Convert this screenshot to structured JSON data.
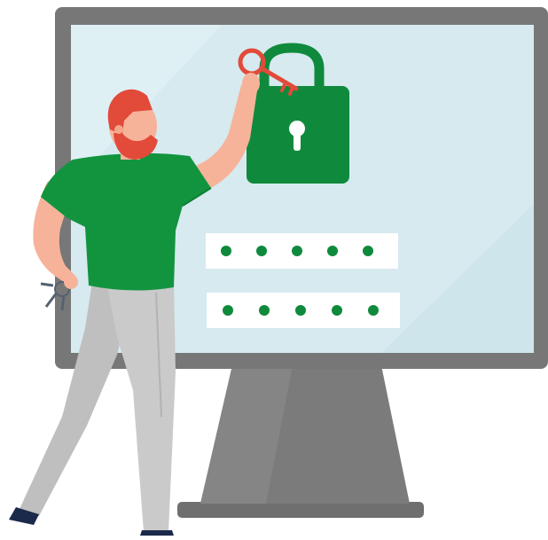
{
  "illustration": {
    "monitor": {
      "frame_color": "#7a7a7a",
      "screen_color": "#d7ebf1",
      "stand_color": "#7d7d7d",
      "base_color": "#737373"
    },
    "padlock": {
      "icon": "padlock-icon",
      "color": "#0f8a3c",
      "shackle_color": "#0f8a3c",
      "keyhole_color": "#ffffff"
    },
    "key": {
      "icon": "key-icon",
      "color": "#e24a3a"
    },
    "password_fields": {
      "dot_color": "#0f8a3c",
      "fields": [
        {
          "dots": 5
        },
        {
          "dots": 5
        }
      ]
    },
    "person": {
      "hair_color": "#e24a3a",
      "skin_color": "#f6b39a",
      "shirt_color": "#12943f",
      "pants_color": "#c9c9c9",
      "shoe_color": "#1b2a4a"
    }
  }
}
